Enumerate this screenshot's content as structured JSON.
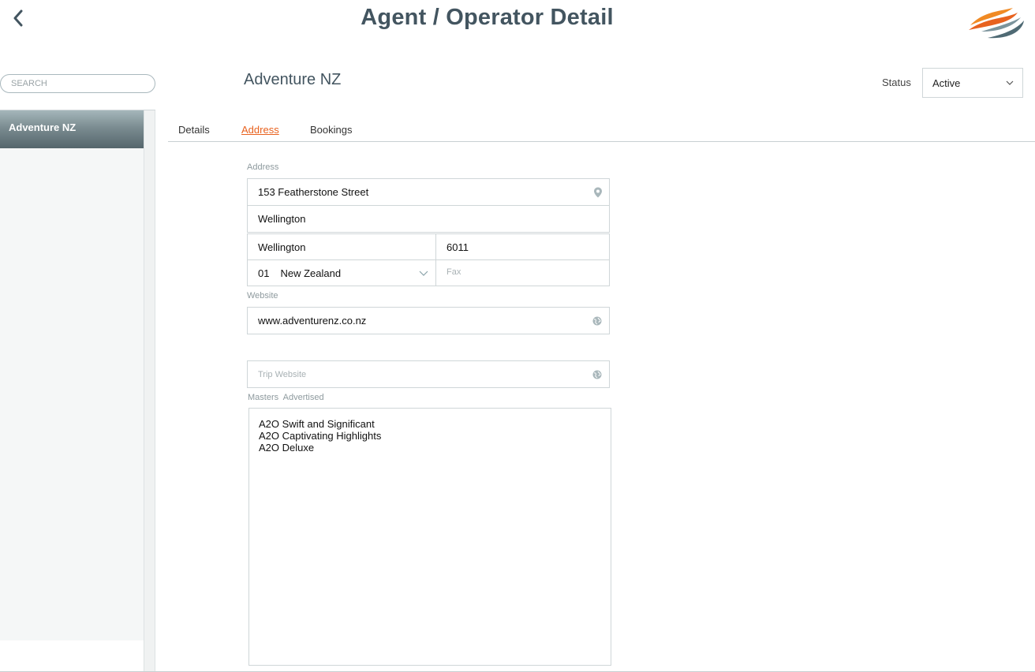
{
  "header": {
    "title": "Agent / Operator Detail",
    "back_icon": "chevron-left-icon",
    "logo": "brand-swoosh-logo"
  },
  "sidebar": {
    "search_placeholder": "SEARCH",
    "items": [
      {
        "label": "Adventure NZ",
        "selected": true
      }
    ]
  },
  "entity": {
    "name": "Adventure NZ",
    "status_label": "Status",
    "status_value": "Active"
  },
  "tabs": [
    {
      "label": "Details",
      "active": false
    },
    {
      "label": "Address",
      "active": true
    },
    {
      "label": "Bookings",
      "active": false
    }
  ],
  "address": {
    "label": "Address",
    "line1": "153 Featherstone Street",
    "line2": "Wellington",
    "city": "Wellington",
    "postcode": "6011",
    "country_code": "01",
    "country": "New Zealand",
    "fax_placeholder": "Fax"
  },
  "website": {
    "label": "Website",
    "value": "www.adventurenz.co.nz"
  },
  "trip_website": {
    "placeholder": "Trip Website"
  },
  "masters": {
    "label": "Masters  Advertised",
    "items": [
      "A2O Swift and Significant",
      "A2O Captivating Highlights",
      "A2O Deluxe"
    ]
  },
  "colors": {
    "title": "#435560",
    "active_tab": "#e8621f",
    "border": "#cfd6d8",
    "sidebar_selected": "#6f8186"
  }
}
